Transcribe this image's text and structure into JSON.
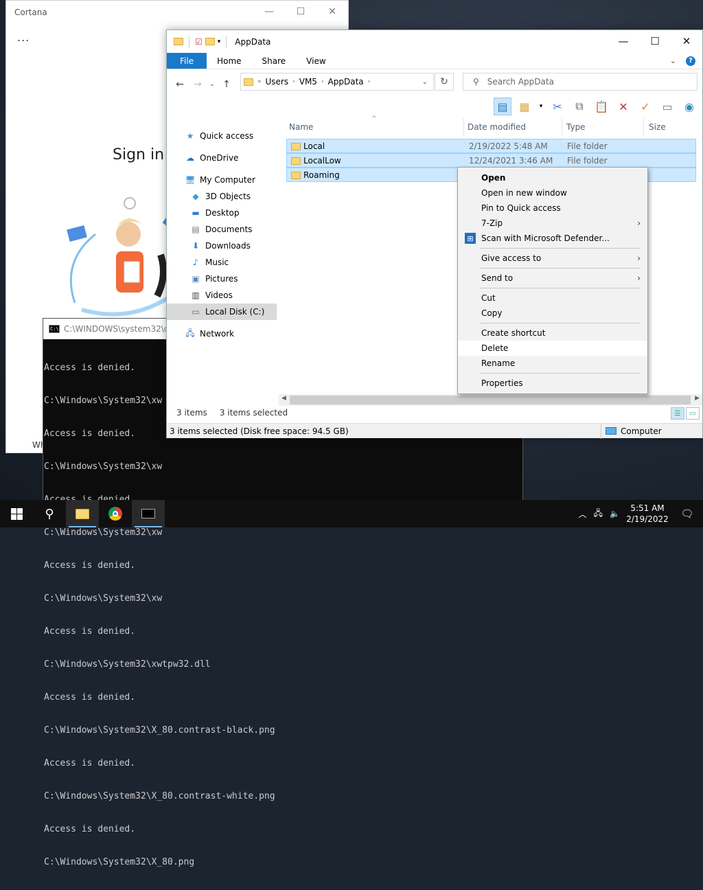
{
  "cortana": {
    "title": "Cortana",
    "more": "...",
    "sign_in": "Sign in",
    "who_text": "Wh"
  },
  "cmd": {
    "title": "C:\\WINDOWS\\system32\\cm",
    "lines": [
      "Access is denied.",
      "C:\\Windows\\System32\\xw",
      "Access is denied.",
      "C:\\Windows\\System32\\xw",
      "Access is denied.",
      "C:\\Windows\\System32\\xw",
      "Access is denied.",
      "C:\\Windows\\System32\\xw",
      "Access is denied.",
      "C:\\Windows\\System32\\xwtpw32.dll",
      "Access is denied.",
      "C:\\Windows\\System32\\X_80.contrast-black.png",
      "Access is denied.",
      "C:\\Windows\\System32\\X_80.contrast-white.png",
      "Access is denied.",
      "C:\\Windows\\System32\\X_80.png"
    ]
  },
  "explorer": {
    "title": "AppData",
    "ribbon_tabs": [
      "File",
      "Home",
      "Share",
      "View"
    ],
    "breadcrumb": [
      "Users",
      "VM5",
      "AppData"
    ],
    "breadcrumb_prefix": "«",
    "search_placeholder": "Search AppData",
    "nav": {
      "quick_access": "Quick access",
      "onedrive": "OneDrive",
      "my_computer": "My Computer",
      "objects3d": "3D Objects",
      "desktop": "Desktop",
      "documents": "Documents",
      "downloads": "Downloads",
      "music": "Music",
      "pictures": "Pictures",
      "videos": "Videos",
      "local_disk": "Local Disk (C:)",
      "network": "Network"
    },
    "columns": [
      "Name",
      "Date modified",
      "Type",
      "Size"
    ],
    "files": [
      {
        "name": "Local",
        "date": "2/19/2022 5:48 AM",
        "type": "File folder"
      },
      {
        "name": "LocalLow",
        "date": "12/24/2021 3:46 AM",
        "type": "File folder"
      },
      {
        "name": "Roaming",
        "date": "",
        "type": ""
      }
    ],
    "status_items": "3 items",
    "status_selected": "3 items selected",
    "details_bar": "3 items selected (Disk free space: 94.5 GB)",
    "details_location": "Computer"
  },
  "context_menu": {
    "items": [
      {
        "label": "Open",
        "bold": true
      },
      {
        "label": "Open in new window"
      },
      {
        "label": "Pin to Quick access"
      },
      {
        "label": "7-Zip",
        "submenu": true
      },
      {
        "label": "Scan with Microsoft Defender..."
      },
      {
        "label": "Give access to",
        "submenu": true
      },
      {
        "label": "Send to",
        "submenu": true
      },
      {
        "label": "Cut"
      },
      {
        "label": "Copy"
      },
      {
        "label": "Create shortcut"
      },
      {
        "label": "Delete"
      },
      {
        "label": "Rename"
      },
      {
        "label": "Properties"
      }
    ]
  },
  "taskbar": {
    "time": "5:51 AM",
    "date": "2/19/2022"
  },
  "colors": {
    "accent": "#1979ca",
    "selection": "#cce8ff"
  }
}
